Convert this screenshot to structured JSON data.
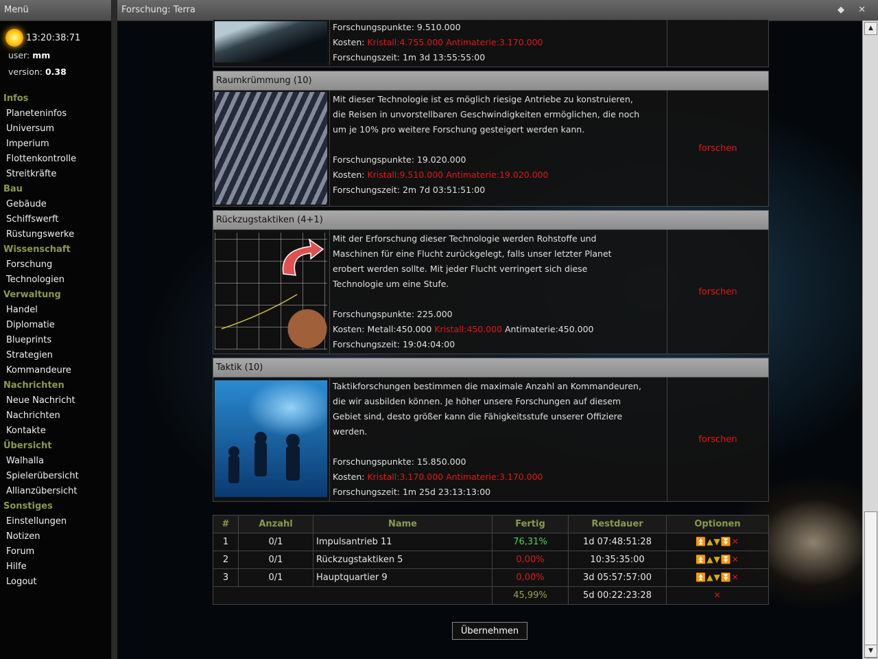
{
  "sidebar": {
    "title": "Menü",
    "clock": "13:20:38:71",
    "user_label": "user:",
    "user_value": "mm",
    "version_label": "version:",
    "version_value": "0.38",
    "sections": [
      {
        "label": "Infos",
        "items": [
          "Planeteninfos",
          "Universum",
          "Imperium",
          "Flottenkontrolle",
          "Streitkräfte"
        ]
      },
      {
        "label": "Bau",
        "items": [
          "Gebäude",
          "Schiffswerft",
          "Rüstungswerke"
        ]
      },
      {
        "label": "Wissenschaft",
        "items": [
          "Forschung",
          "Technologien"
        ]
      },
      {
        "label": "Verwaltung",
        "items": [
          "Handel",
          "Diplomatie",
          "Blueprints",
          "Strategien",
          "Kommandeure"
        ]
      },
      {
        "label": "Nachrichten",
        "items": [
          "Neue Nachricht",
          "Nachrichten",
          "Kontakte"
        ]
      },
      {
        "label": "Übersicht",
        "items": [
          "Walhalla",
          "Spielerübersicht",
          "Allianzübersicht"
        ]
      },
      {
        "label": "Sonstiges",
        "items": [
          "Einstellungen",
          "Notizen",
          "Forum",
          "Hilfe",
          "Logout"
        ]
      }
    ]
  },
  "window": {
    "title": "Forschung: Terra",
    "controls": "◆ ✕"
  },
  "entries": [
    {
      "title": "",
      "desc_lines": [],
      "points": "Forschungspunkte: 9.510.000",
      "cost_label": "Kosten: ",
      "cost_parts": [
        {
          "text": "Kristall:4.755.000 Antimaterie:3.170.000",
          "red": true
        }
      ],
      "time": "Forschungszeit: 1m 3d 13:55:55:00",
      "action": ""
    },
    {
      "title": "Raumkrümmung (10)",
      "desc_lines": [
        "Mit dieser Technologie ist es möglich riesige Antriebe zu konstruieren,",
        "die Reisen in unvorstellbaren Geschwindigkeiten ermöglichen, die noch",
        "um je 10% pro weitere Forschung gesteigert werden kann."
      ],
      "points": "Forschungspunkte: 19.020.000",
      "cost_label": "Kosten: ",
      "cost_parts": [
        {
          "text": "Kristall:9.510.000 Antimaterie:19.020.000",
          "red": true
        }
      ],
      "time": "Forschungszeit: 2m 7d 03:51:51:00",
      "action": "forschen"
    },
    {
      "title": "Rückzugstaktiken (4+1)",
      "desc_lines": [
        "Mit der Erforschung dieser Technologie werden Rohstoffe und",
        "Maschinen für eine Flucht zurückgelegt, falls unser letzter Planet",
        "erobert werden sollte. Mit jeder Flucht verringert sich diese",
        "Technologie um eine Stufe."
      ],
      "points": "Forschungspunkte: 225.000",
      "cost_label": "Kosten: ",
      "cost_parts": [
        {
          "text": "Metall:450.000 ",
          "red": false
        },
        {
          "text": "Kristall:450.000",
          "red": true
        },
        {
          "text": " Antimaterie:450.000",
          "red": false
        }
      ],
      "time": "Forschungszeit: 19:04:04:00",
      "action": "forschen"
    },
    {
      "title": "Taktik (10)",
      "desc_lines": [
        "Taktikforschungen bestimmen die maximale Anzahl an Kommandeuren,",
        "die wir ausbilden können. Je höher unsere Forschungen auf diesem",
        "Gebiet sind, desto größer kann die Fähigkeitsstufe unserer Offiziere",
        "werden."
      ],
      "points": "Forschungspunkte: 15.850.000",
      "cost_label": "Kosten: ",
      "cost_parts": [
        {
          "text": "Kristall:3.170.000 Antimaterie:3.170.000",
          "red": true
        }
      ],
      "time": "Forschungszeit: 1m 25d 23:13:13:00",
      "action": "forschen"
    }
  ],
  "queue": {
    "headers": [
      "#",
      "Anzahl",
      "Name",
      "Fertig",
      "Restdauer",
      "Optionen"
    ],
    "rows": [
      {
        "num": "1",
        "count": "0/1",
        "name": "Impulsantrieb 11",
        "done": "76,31%",
        "done_color": "#4fd04f",
        "remaining": "1d 07:48:51:28"
      },
      {
        "num": "2",
        "count": "0/1",
        "name": "Rückzugstaktiken 5",
        "done": "0,00%",
        "done_color": "#e01818",
        "remaining": "10:35:35:00"
      },
      {
        "num": "3",
        "count": "0/1",
        "name": "Hauptquartier 9",
        "done": "0,00%",
        "done_color": "#e01818",
        "remaining": "3d 05:57:57:00"
      }
    ],
    "total_done": "45,99%",
    "total_remaining": "5d 00:22:23:28"
  },
  "apply_button": "Übernehmen"
}
